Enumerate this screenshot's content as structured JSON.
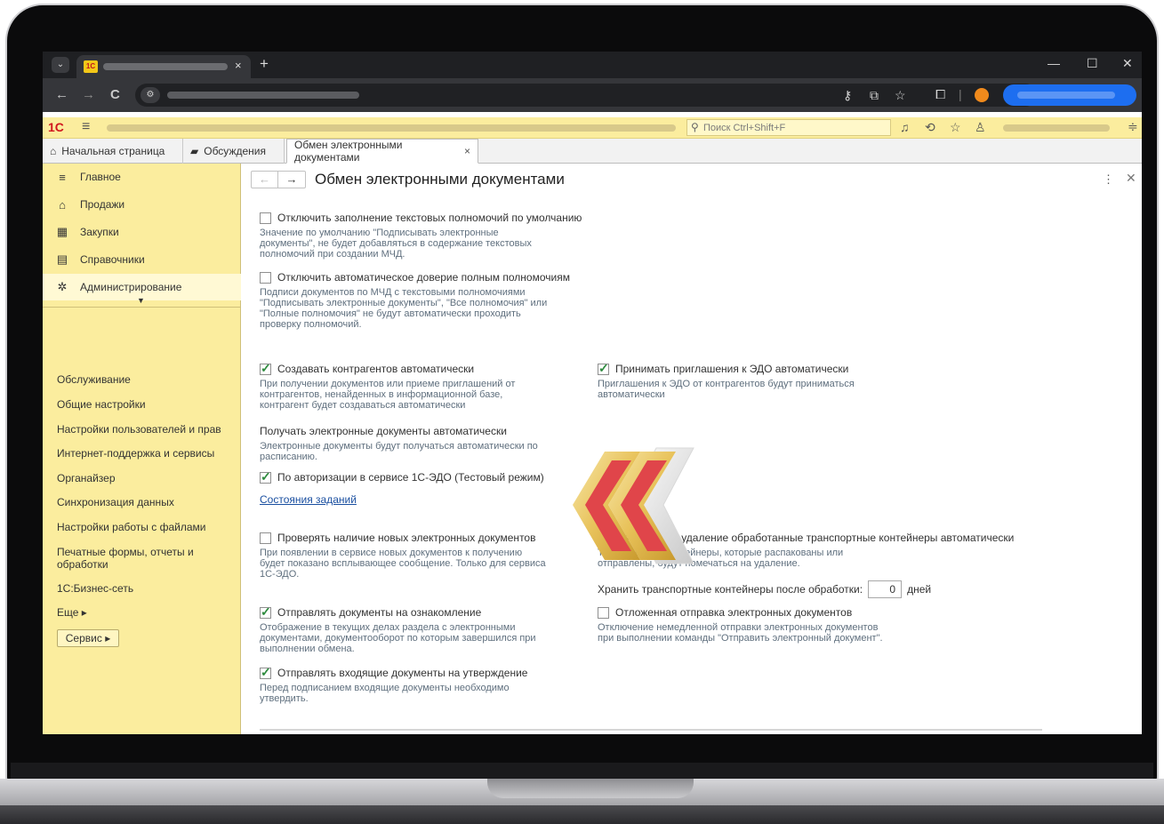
{
  "browser": {
    "tab_favicon": "1С",
    "tab_close": "×",
    "new_tab": "+",
    "menu": "⌄",
    "window_min": "—",
    "window_max": "☐",
    "window_close": "✕",
    "nav_back": "←",
    "nav_forward": "→",
    "nav_reload": "C",
    "site_icon": "⚙"
  },
  "onec": {
    "logo": "1С",
    "search_placeholder": "Поиск Ctrl+Shift+F"
  },
  "section_tabs": [
    {
      "label": "Начальная страница",
      "icon": "home-icon"
    },
    {
      "label": "Обсуждения",
      "icon": "chat-icon"
    },
    {
      "label": "Обмен электронными документами",
      "close": "×"
    }
  ],
  "sidebar": {
    "items": [
      {
        "label": "Главное",
        "icon": "menu-lines-icon"
      },
      {
        "label": "Продажи",
        "icon": "store-icon"
      },
      {
        "label": "Закупки",
        "icon": "cart-icon"
      },
      {
        "label": "Справочники",
        "icon": "book-icon"
      },
      {
        "label": "Администрирование",
        "icon": "gear-icon"
      }
    ],
    "subitems": [
      "Обслуживание",
      "Общие настройки",
      "Настройки пользователей и прав",
      "Интернет-поддержка и сервисы",
      "Органайзер",
      "Синхронизация данных",
      "Настройки работы с файлами",
      "Печатные формы, отчеты и обработки",
      "1С:Бизнес-сеть",
      "Еще ▸"
    ],
    "service_button": "Сервис ▸"
  },
  "content": {
    "title": "Обмен электронными документами",
    "options": {
      "disable_text_powers": {
        "label": "Отключить заполнение текстовых полномочий по умолчанию",
        "checked": false,
        "hint": [
          "Значение по умолчанию \"Подписывать электронные",
          "документы\", не будет добавляться в содержание текстовых",
          "полномочий при создании МЧД."
        ]
      },
      "disable_auto_trust": {
        "label": "Отключить автоматическое доверие полным полномочиям",
        "checked": false,
        "hint": [
          "Подписи документов по МЧД с текстовыми полномочиями",
          "\"Подписывать электронные документы\", \"Все полномочия\" или",
          "\"Полные полномочия\" не будут автоматически проходить",
          "проверку полномочий."
        ]
      },
      "create_counterparties": {
        "label": "Создавать контрагентов автоматически",
        "checked": true,
        "hint": [
          "При получении документов или приеме приглашений от",
          "контрагентов, ненайденных в информационной базе,",
          "контрагент будет создаваться автоматически"
        ]
      },
      "accept_invites": {
        "label": "Принимать приглашения к ЭДО автоматически",
        "checked": true,
        "hint": [
          "Приглашения к ЭДО от контрагентов будут приниматься",
          "автоматически"
        ]
      },
      "receive_auto": {
        "label": "Получать электронные документы автоматически",
        "hint": [
          "Электронные документы будут получаться автоматически по",
          "расписанию."
        ]
      },
      "by_auth": {
        "label": "По авторизации в сервисе 1С-ЭДО (Тестовый режим)",
        "checked": true
      },
      "jobs_link": "Состояния заданий",
      "check_new": {
        "label": "Проверять наличие новых электронных документов",
        "checked": false,
        "hint": [
          "При появлении в сервисе новых документов к получению",
          "будет показано всплывающее сообщение. Только для сервиса",
          "1С-ЭДО."
        ]
      },
      "mark_containers": {
        "label": "Помечать на удаление обработанные транспортные контейнеры автоматически",
        "checked": false,
        "hint": [
          "Транспортные контейнеры, которые распакованы или",
          "отправлены, будут помечаться на удаление."
        ]
      },
      "keep_containers": {
        "label": "Хранить транспортные контейнеры после обработки:",
        "value": "0",
        "unit": "дней"
      },
      "send_review": {
        "label": "Отправлять документы на ознакомление",
        "checked": true,
        "hint": [
          "Отображение в текущих делах  раздела с электронными",
          "документами, документооборот по которым завершился при",
          "выполнении обмена."
        ]
      },
      "delayed_send": {
        "label": "Отложенная отправка электронных документов",
        "checked": false,
        "hint": [
          "Отключение немедленной отправки электронных документов",
          "при выполнении команды \"Отправить электронный документ\"."
        ]
      },
      "send_incoming": {
        "label": "Отправлять входящие документы на утверждение",
        "checked": true,
        "hint": [
          "Перед подписанием входящие документы необходимо",
          "утвердить."
        ]
      }
    }
  },
  "colors": {
    "onec_yellow": "#fbed9e",
    "check_green": "#2e8b3e",
    "link_blue": "#1a4fa0",
    "hint_gray": "#5f6f7e",
    "logo_red": "#d0161e"
  }
}
